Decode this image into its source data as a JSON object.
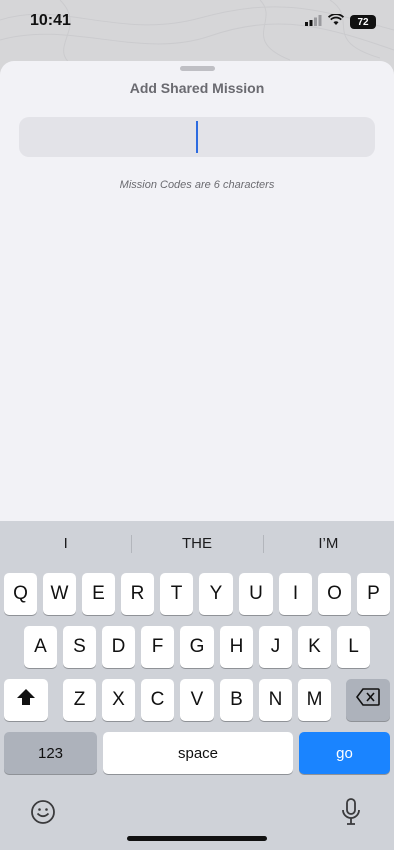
{
  "status_bar": {
    "time": "10:41",
    "battery": "72"
  },
  "sheet": {
    "title": "Add Shared Mission",
    "input_value": "",
    "hint": "Mission Codes are 6 characters"
  },
  "keyboard": {
    "suggestions": [
      "I",
      "THE",
      "I’M"
    ],
    "row1": [
      "Q",
      "W",
      "E",
      "R",
      "T",
      "Y",
      "U",
      "I",
      "O",
      "P"
    ],
    "row2": [
      "A",
      "S",
      "D",
      "F",
      "G",
      "H",
      "J",
      "K",
      "L"
    ],
    "row3": [
      "Z",
      "X",
      "C",
      "V",
      "B",
      "N",
      "M"
    ],
    "numbers_label": "123",
    "space_label": "space",
    "go_label": "go"
  },
  "colors": {
    "accent": "#1a84ff",
    "caret": "#2d6be0"
  }
}
